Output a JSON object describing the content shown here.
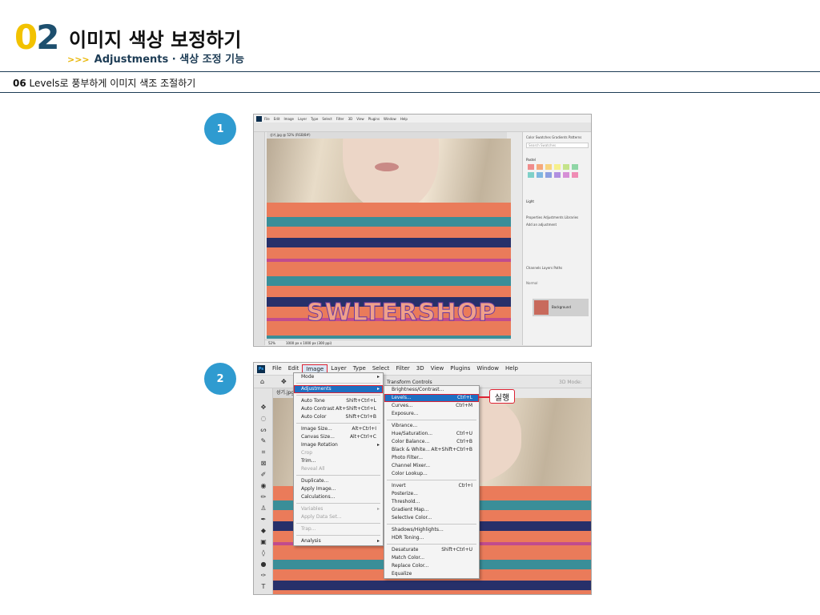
{
  "header": {
    "chapter_digit_1": "0",
    "chapter_digit_2": "2",
    "title": "이미지 색상 보정하기",
    "subtitle_marker": ">>>",
    "subtitle": "Adjustments · 색상 조정 기능"
  },
  "section": {
    "number": "06",
    "title": "Levels로 풍부하게 이미지 색조 조절하기"
  },
  "steps": [
    "1",
    "2"
  ],
  "screenshot1": {
    "menu_items": [
      "File",
      "Edit",
      "Image",
      "Layer",
      "Type",
      "Select",
      "Filter",
      "3D",
      "View",
      "Plugins",
      "Window",
      "Help"
    ],
    "doc_tab": "성기.jpg @ 52% (RGB/8#)",
    "zoom": "52%",
    "dimensions": "1000 px x 1000 px (300 ppi)",
    "panel_tabs": [
      "Color",
      "Swatches",
      "Gradients",
      "Patterns"
    ],
    "search_placeholder": "Search Swatches",
    "swatch_group_1": "Pastel",
    "swatch_group_2": "Light",
    "adj_tabs": [
      "Properties",
      "Adjustments",
      "Libraries"
    ],
    "adj_label": "Add an adjustment",
    "layer_tabs": [
      "Channels",
      "Layers",
      "Paths"
    ],
    "blend_mode": "Normal",
    "layer_name": "Background",
    "sweater_text": "SWLTERSHOP",
    "colors": {
      "swatches": [
        "#f08c8c",
        "#f5a87a",
        "#f7d47e",
        "#f6f08c",
        "#c4e38a",
        "#8fd6a6",
        "#7ed0c8",
        "#7fb7e0",
        "#8c9fe0",
        "#b08fe0",
        "#d68fd6",
        "#f08cb4"
      ]
    }
  },
  "screenshot2": {
    "logo": "Ps",
    "menu_items": [
      "File",
      "Edit",
      "Image",
      "Layer",
      "Type",
      "Select",
      "Filter",
      "3D",
      "View",
      "Plugins",
      "Window",
      "Help"
    ],
    "options_text_1": "Transform Controls",
    "options_text_2": "3D Mode:",
    "doc_tab": "성기.jpg",
    "image_menu": [
      {
        "label": "Mode",
        "shortcut": "",
        "submenu": true,
        "state": "normal"
      },
      {
        "sep": true
      },
      {
        "label": "Adjustments",
        "shortcut": "",
        "submenu": true,
        "state": "highlight-box"
      },
      {
        "sep": true
      },
      {
        "label": "Auto Tone",
        "shortcut": "Shift+Ctrl+L",
        "state": "normal"
      },
      {
        "label": "Auto Contrast",
        "shortcut": "Alt+Shift+Ctrl+L",
        "state": "normal"
      },
      {
        "label": "Auto Color",
        "shortcut": "Shift+Ctrl+B",
        "state": "normal"
      },
      {
        "sep": true
      },
      {
        "label": "Image Size...",
        "shortcut": "Alt+Ctrl+I",
        "state": "normal"
      },
      {
        "label": "Canvas Size...",
        "shortcut": "Alt+Ctrl+C",
        "state": "normal"
      },
      {
        "label": "Image Rotation",
        "shortcut": "",
        "submenu": true,
        "state": "normal"
      },
      {
        "label": "Crop",
        "shortcut": "",
        "state": "disabled"
      },
      {
        "label": "Trim...",
        "shortcut": "",
        "state": "normal"
      },
      {
        "label": "Reveal All",
        "shortcut": "",
        "state": "disabled"
      },
      {
        "sep": true
      },
      {
        "label": "Duplicate...",
        "shortcut": "",
        "state": "normal"
      },
      {
        "label": "Apply Image...",
        "shortcut": "",
        "state": "normal"
      },
      {
        "label": "Calculations...",
        "shortcut": "",
        "state": "normal"
      },
      {
        "sep": true
      },
      {
        "label": "Variables",
        "shortcut": "",
        "submenu": true,
        "state": "disabled"
      },
      {
        "label": "Apply Data Set...",
        "shortcut": "",
        "state": "disabled"
      },
      {
        "sep": true
      },
      {
        "label": "Trap...",
        "shortcut": "",
        "state": "disabled"
      },
      {
        "sep": true
      },
      {
        "label": "Analysis",
        "shortcut": "",
        "submenu": true,
        "state": "normal"
      }
    ],
    "adjust_menu": [
      {
        "label": "Brightness/Contrast...",
        "shortcut": "",
        "state": "normal"
      },
      {
        "label": "Levels...",
        "shortcut": "Ctrl+L",
        "state": "highlight-box"
      },
      {
        "label": "Curves...",
        "shortcut": "Ctrl+M",
        "state": "normal"
      },
      {
        "label": "Exposure...",
        "shortcut": "",
        "state": "normal"
      },
      {
        "sep": true
      },
      {
        "label": "Vibrance...",
        "shortcut": "",
        "state": "normal"
      },
      {
        "label": "Hue/Saturation...",
        "shortcut": "Ctrl+U",
        "state": "normal"
      },
      {
        "label": "Color Balance...",
        "shortcut": "Ctrl+B",
        "state": "normal"
      },
      {
        "label": "Black & White...",
        "shortcut": "Alt+Shift+Ctrl+B",
        "state": "normal"
      },
      {
        "label": "Photo Filter...",
        "shortcut": "",
        "state": "normal"
      },
      {
        "label": "Channel Mixer...",
        "shortcut": "",
        "state": "normal"
      },
      {
        "label": "Color Lookup...",
        "shortcut": "",
        "state": "normal"
      },
      {
        "sep": true
      },
      {
        "label": "Invert",
        "shortcut": "Ctrl+I",
        "state": "normal"
      },
      {
        "label": "Posterize...",
        "shortcut": "",
        "state": "normal"
      },
      {
        "label": "Threshold...",
        "shortcut": "",
        "state": "normal"
      },
      {
        "label": "Gradient Map...",
        "shortcut": "",
        "state": "normal"
      },
      {
        "label": "Selective Color...",
        "shortcut": "",
        "state": "normal"
      },
      {
        "sep": true
      },
      {
        "label": "Shadows/Highlights...",
        "shortcut": "",
        "state": "normal"
      },
      {
        "label": "HDR Toning...",
        "shortcut": "",
        "state": "normal"
      },
      {
        "sep": true
      },
      {
        "label": "Desaturate",
        "shortcut": "Shift+Ctrl+U",
        "state": "normal"
      },
      {
        "label": "Match Color...",
        "shortcut": "",
        "state": "normal"
      },
      {
        "label": "Replace Color...",
        "shortcut": "",
        "state": "normal"
      },
      {
        "label": "Equalize",
        "shortcut": "",
        "state": "normal"
      }
    ],
    "callout": "실행"
  }
}
